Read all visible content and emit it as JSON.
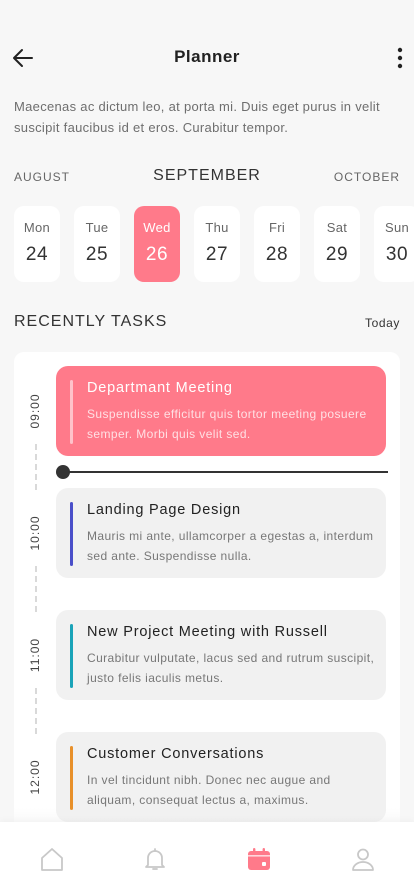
{
  "header": {
    "title": "Planner",
    "back_icon": "arrow-left-icon",
    "more_icon": "more-vertical-icon"
  },
  "description": "Maecenas ac dictum leo, at porta mi. Duis eget purus in velit suscipit faucibus id et eros. Curabitur tempor.",
  "months": {
    "prev": "AUGUST",
    "current": "SEPTEMBER",
    "next": "OCTOBER"
  },
  "days": [
    {
      "name": "Mon",
      "num": "24"
    },
    {
      "name": "Tue",
      "num": "25"
    },
    {
      "name": "Wed",
      "num": "26",
      "selected": true
    },
    {
      "name": "Thu",
      "num": "27"
    },
    {
      "name": "Fri",
      "num": "28"
    },
    {
      "name": "Sat",
      "num": "29"
    },
    {
      "name": "Sun",
      "num": "30"
    }
  ],
  "tasks_section": {
    "title": "RECENTLY TASKS",
    "filter": "Today"
  },
  "timeline": {
    "times": [
      "09:00",
      "10:00",
      "11:00",
      "12:00"
    ]
  },
  "tasks": [
    {
      "title": "Departmant Meeting",
      "desc": "Suspendisse efficitur quis tortor meeting posuere semper. Morbi quis velit sed.",
      "accent": "#ffc2ca",
      "highlight": true
    },
    {
      "title": "Landing Page Design",
      "desc": "Mauris mi ante, ullamcorper a egestas a, interdum sed ante. Suspendisse nulla.",
      "accent": "#4a4fc9"
    },
    {
      "title": "New Project Meeting with Russell",
      "desc": "Curabitur vulputate, lacus sed and rutrum suscipit, justo felis iaculis metus.",
      "accent": "#1aa3b8"
    },
    {
      "title": "Customer Conversations",
      "desc": "In vel tincidunt nibh. Donec nec augue and aliquam, consequat lectus a, maximus.",
      "accent": "#e8902a"
    }
  ],
  "bottom_nav": [
    {
      "icon": "home-icon",
      "active": false
    },
    {
      "icon": "bell-icon",
      "active": false
    },
    {
      "icon": "calendar-icon",
      "active": true
    },
    {
      "icon": "user-icon",
      "active": false
    }
  ],
  "colors": {
    "accent": "#ff7a8a",
    "background": "#f7f7f7",
    "text_dark": "#222222"
  }
}
